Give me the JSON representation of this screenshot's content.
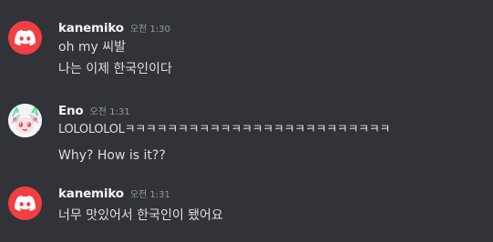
{
  "messages": [
    {
      "username": "kanemiko",
      "timestamp": "오전 1:30",
      "avatar": "discord-default-avatar-red",
      "lines": [
        "oh my 씨발",
        "나는 이제 한국인이다"
      ]
    },
    {
      "username": "Eno",
      "timestamp": "오전 1:31",
      "avatar": "anime-character-avatar",
      "lines": [
        "LOLOLOLOLㅋㅋㅋㅋㅋㅋㅋㅋㅋㅋㅋㅋㅋㅋㅋㅋㅋㅋㅋㅋㅋㅋㅋㅋㅋ",
        "Why? How is it??"
      ]
    },
    {
      "username": "kanemiko",
      "timestamp": "오전 1:31",
      "avatar": "discord-default-avatar-red",
      "lines": [
        "너무 맛있어서 한국인이 됐어요"
      ]
    }
  ],
  "colors": {
    "background": "#313338",
    "username": "#f2f3f5",
    "timestamp": "#949ba4",
    "message_text": "#dbdee1",
    "discord_avatar": "#f23f43"
  }
}
